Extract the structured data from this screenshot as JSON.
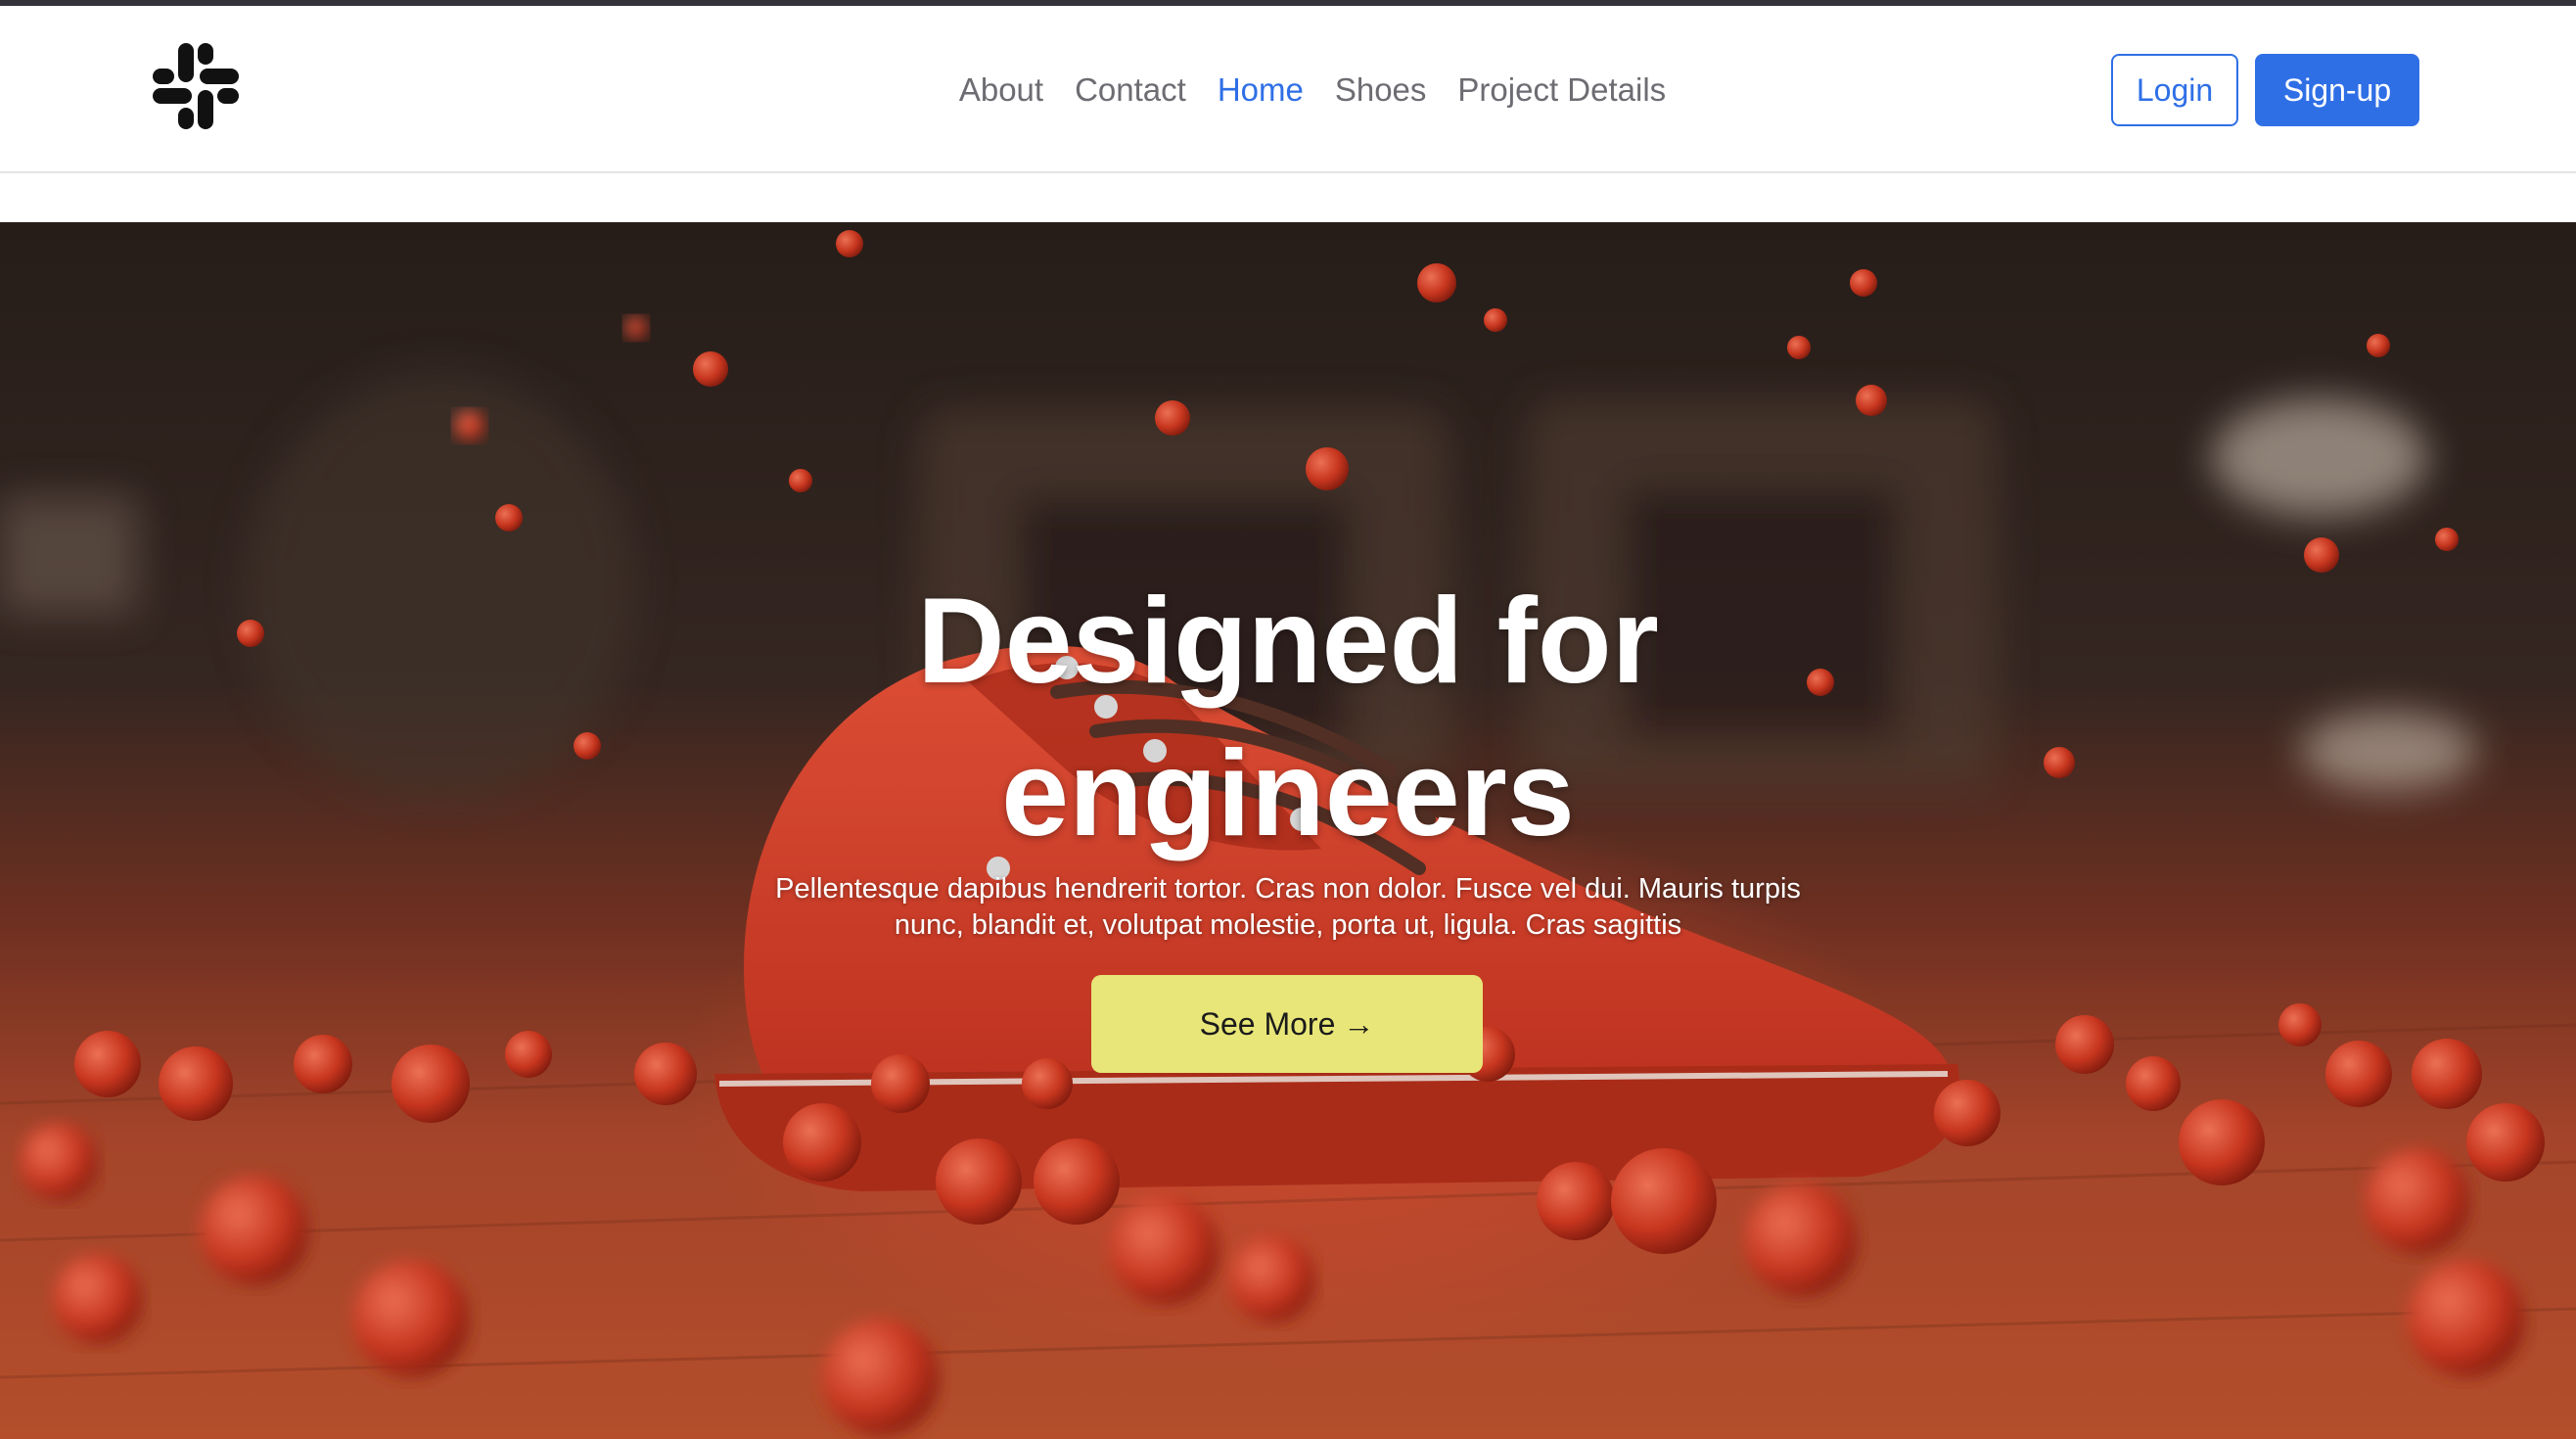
{
  "brand": {
    "logo_icon": "slack-hash-logo"
  },
  "nav": {
    "links": [
      {
        "label": "About",
        "active": false
      },
      {
        "label": "Contact",
        "active": false
      },
      {
        "label": "Home",
        "active": true
      },
      {
        "label": "Shoes",
        "active": false
      },
      {
        "label": "Project Details",
        "active": false
      }
    ],
    "login_label": "Login",
    "signup_label": "Sign-up"
  },
  "hero": {
    "title_line1": "Designed for",
    "title_line2": "engineers",
    "subtitle": "Pellentesque dapibus hendrerit tortor. Cras non dolor. Fusce vel dui. Mauris turpis nunc, blandit et, volutpat molestie, porta ut, ligula. Cras sagittis",
    "cta_label": "See More",
    "cta_icon": "arrow-right-icon",
    "image_subject": "red-sneaker-on-wooden-floor"
  },
  "colors": {
    "accent": "#2f6fe6",
    "cta": "#e8e678",
    "nav_text": "#6c6c72"
  }
}
